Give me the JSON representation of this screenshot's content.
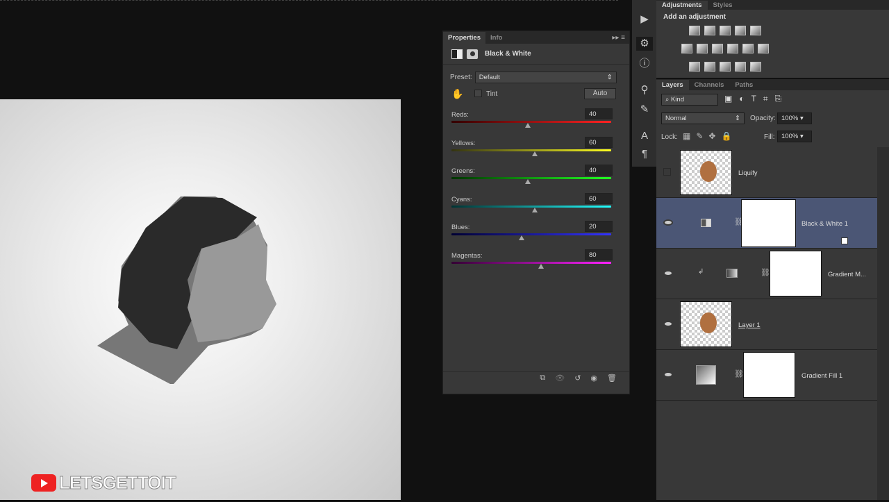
{
  "properties": {
    "tabs": [
      "Properties",
      "Info"
    ],
    "title": "Black & White",
    "preset_label": "Preset:",
    "preset_value": "Default",
    "tint_label": "Tint",
    "auto_label": "Auto",
    "sliders": [
      {
        "label": "Reds:",
        "value": "40",
        "pct": 0.48,
        "grad": "linear-gradient(90deg,#300,#f22)"
      },
      {
        "label": "Yellows:",
        "value": "60",
        "pct": 0.52,
        "grad": "linear-gradient(90deg,#331,#ff2)"
      },
      {
        "label": "Greens:",
        "value": "40",
        "pct": 0.48,
        "grad": "linear-gradient(90deg,#030,#2f2)"
      },
      {
        "label": "Cyans:",
        "value": "60",
        "pct": 0.52,
        "grad": "linear-gradient(90deg,#033,#2ff)"
      },
      {
        "label": "Blues:",
        "value": "20",
        "pct": 0.44,
        "grad": "linear-gradient(90deg,#003,#33f)"
      },
      {
        "label": "Magentas:",
        "value": "80",
        "pct": 0.56,
        "grad": "linear-gradient(90deg,#303,#f2f)"
      }
    ]
  },
  "adjustments": {
    "tabs": [
      "Adjustments",
      "Styles"
    ],
    "heading": "Add an adjustment"
  },
  "layers_panel": {
    "tabs": [
      "Layers",
      "Channels",
      "Paths"
    ],
    "filter": "Kind",
    "blend": "Normal",
    "opacity_label": "Opacity:",
    "opacity": "100%",
    "lock_label": "Lock:",
    "fill_label": "Fill:",
    "fill": "100%",
    "layers": [
      "Liquify",
      "Black & White 1",
      "Gradient M...",
      "Layer 1",
      "Gradient Fill 1"
    ]
  },
  "watermark": "LETSGETTOIT"
}
